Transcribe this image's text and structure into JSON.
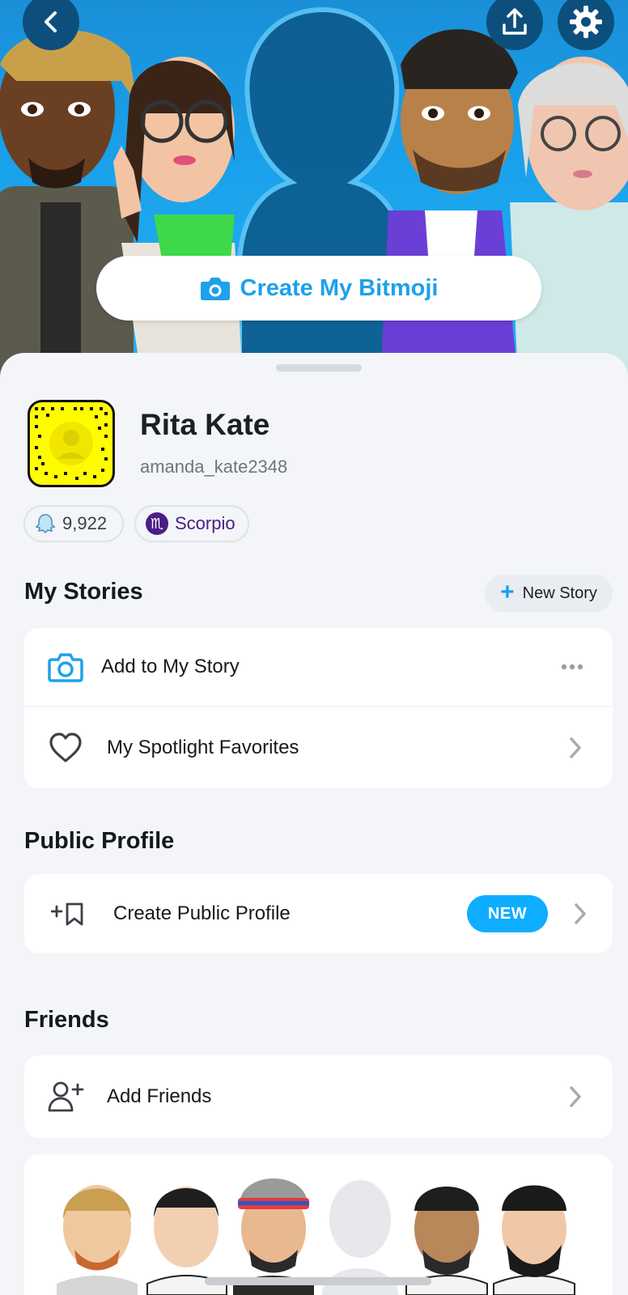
{
  "hero": {
    "create_bitmoji_label": "Create My Bitmoji",
    "icons": [
      "back-icon",
      "share-icon",
      "settings-icon",
      "camera-icon"
    ]
  },
  "profile": {
    "display_name": "Rita Kate",
    "username": "amanda_kate2348",
    "snap_score": "9,922",
    "zodiac": "Scorpio",
    "zodiac_symbol": "♏"
  },
  "my_stories": {
    "title": "My Stories",
    "new_story_label": "New Story",
    "items": [
      {
        "label": "Add to My Story",
        "icon": "camera-icon",
        "trailing": "more-icon"
      },
      {
        "label": "My Spotlight Favorites",
        "icon": "heart-icon",
        "trailing": "chevron-right-icon"
      }
    ]
  },
  "public_profile": {
    "title": "Public Profile",
    "items": [
      {
        "label": "Create Public Profile",
        "badge": "NEW",
        "icon": "bookmark-plus-icon"
      }
    ]
  },
  "friends": {
    "title": "Friends",
    "items": [
      {
        "label": "Add Friends",
        "icon": "add-person-icon"
      }
    ]
  },
  "colors": {
    "accent": "#1ea1ea",
    "badge_blue": "#0fadff",
    "snapcode_yellow": "#fffc00",
    "zodiac_purple": "#4a1d87",
    "hero_blue": "#1aa2ec"
  }
}
